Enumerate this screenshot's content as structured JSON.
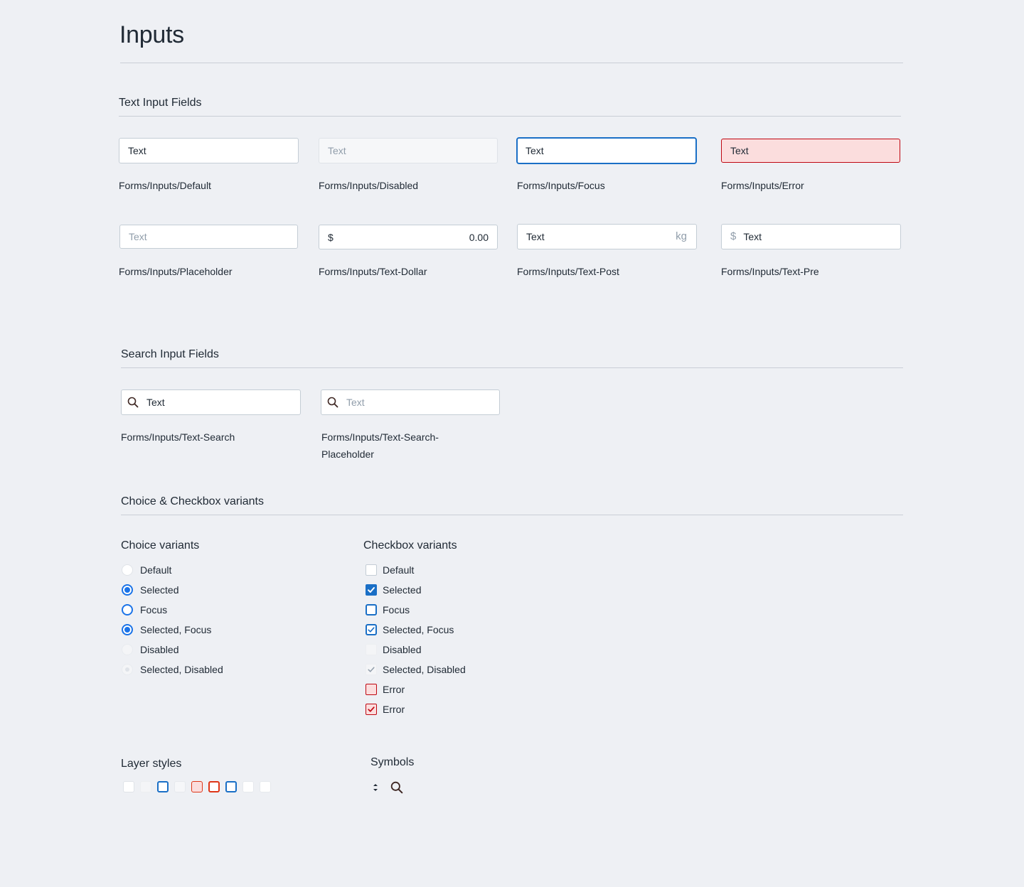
{
  "page": {
    "title": "Inputs"
  },
  "text_section": {
    "title": "Text Input Fields",
    "fields": [
      {
        "value": "Text",
        "caption": "Forms/Inputs/Default"
      },
      {
        "placeholder": "Text",
        "caption": "Forms/Inputs/Disabled"
      },
      {
        "value": "Text",
        "caption": "Forms/Inputs/Focus"
      },
      {
        "value": "Text",
        "caption": "Forms/Inputs/Error"
      },
      {
        "placeholder": "Text",
        "caption": "Forms/Inputs/Placeholder"
      },
      {
        "prefix": "$",
        "value": "0.00",
        "caption": "Forms/Inputs/Text-Dollar"
      },
      {
        "value": "Text",
        "suffix": "kg",
        "caption": "Forms/Inputs/Text-Post"
      },
      {
        "prefix": "$",
        "value": "Text",
        "caption": "Forms/Inputs/Text-Pre"
      }
    ]
  },
  "search_section": {
    "title": "Search Input Fields",
    "fields": [
      {
        "value": "Text",
        "caption": "Forms/Inputs/Text-Search"
      },
      {
        "placeholder": "Text",
        "caption_line1": "Forms/Inputs/Text-Search-",
        "caption_line2": "Placeholder"
      }
    ]
  },
  "choice_section": {
    "title": "Choice & Checkbox variants",
    "choice": {
      "title": "Choice variants",
      "items": [
        "Default",
        "Selected",
        "Focus",
        "Selected, Focus",
        "Disabled",
        "Selected, Disabled"
      ]
    },
    "checkbox": {
      "title": "Checkbox variants",
      "items": [
        "Default",
        "Selected",
        "Focus",
        "Selected, Focus",
        "Disabled",
        "Selected, Disabled",
        "Error",
        "Error"
      ]
    }
  },
  "layer_styles": {
    "title": "Layer styles"
  },
  "symbols": {
    "title": "Symbols",
    "icons": [
      "select-arrows-icon",
      "search-icon"
    ]
  },
  "colors": {
    "accent": "#1a6fc6",
    "error": "#bf0711",
    "error_bg": "#fbdddd",
    "background": "#eef0f4"
  }
}
